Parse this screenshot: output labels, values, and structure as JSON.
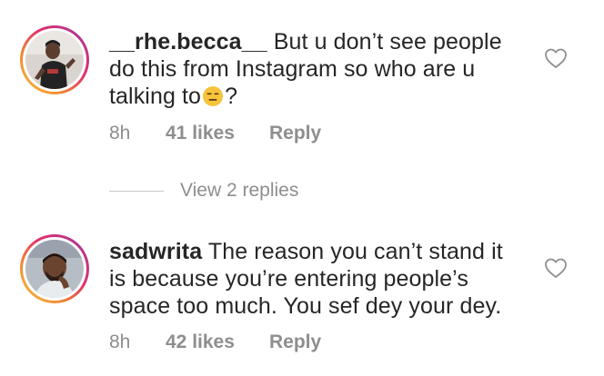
{
  "comments": [
    {
      "username": "__rhe.becca__",
      "text_before_emoji": "But u don’t see people do this from Instagram so who are u talking to",
      "emoji": "expressionless-face",
      "text_after_emoji": "?",
      "time": "8h",
      "likes": "41 likes",
      "reply_label": "Reply"
    },
    {
      "username": "sadwrita",
      "text": "The reason you can’t stand it is because you’re entering people’s space too much. You sef dey your dey.",
      "time": "8h",
      "likes": "42 likes",
      "reply_label": "Reply"
    }
  ],
  "view_replies": "View 2 replies",
  "icons": {
    "like": "heart-outline-icon"
  },
  "colors": {
    "text": "#262626",
    "secondary": "#8e8e8e",
    "ring_gradient": [
      "#f9c543",
      "#e1306c",
      "#833ab4"
    ]
  }
}
